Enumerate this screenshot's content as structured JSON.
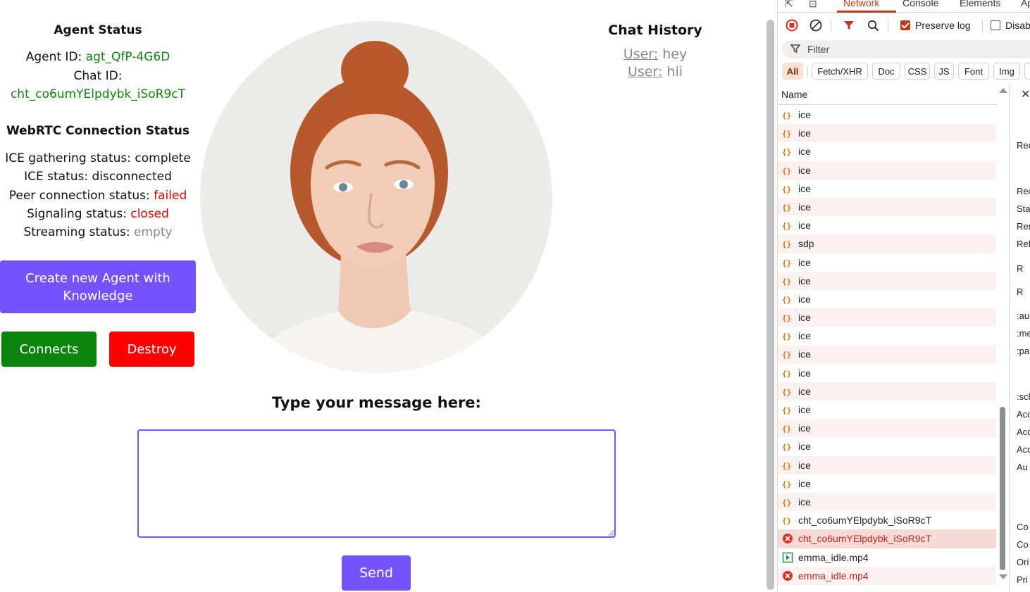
{
  "agent_status": {
    "title": "Agent Status",
    "agent_id_label": "Agent ID: ",
    "agent_id_value": "agt_QfP-4G6D",
    "chat_id_label": "Chat ID:",
    "chat_id_value": "cht_co6umYElpdybk_iSoR9cT"
  },
  "webrtc": {
    "title": "WebRTC Connection Status",
    "ice_gathering_label": "ICE gathering status: ",
    "ice_gathering_value": "complete",
    "ice_label": "ICE status: ",
    "ice_value": "disconnected",
    "peer_label": "Peer connection status: ",
    "peer_value": "failed",
    "signaling_label": "Signaling status: ",
    "signaling_value": "closed",
    "streaming_label": "Streaming status: ",
    "streaming_value": "empty"
  },
  "buttons": {
    "create": "Create new Agent with Knowledge",
    "connect": "Connects",
    "destroy": "Destroy",
    "send": "Send"
  },
  "chat_history": {
    "title": "Chat History",
    "messages": [
      {
        "user": "User:",
        "text": " hey"
      },
      {
        "user": "User:",
        "text": " hii"
      }
    ]
  },
  "message": {
    "label": "Type your message here:",
    "value": ""
  },
  "colors": {
    "accent": "#7352ff",
    "connect": "#0a840a",
    "destroy": "#ff0000",
    "status_green": "#128212",
    "status_red": "#ee0000"
  },
  "devtools": {
    "tabs": [
      "Network",
      "Console",
      "Elements",
      "Ap"
    ],
    "active_tab": "Network",
    "preserve_log": "Preserve log",
    "disable_cache": "Disab",
    "filter_placeholder": "Filter",
    "chips": [
      "All",
      "Fetch/XHR",
      "Doc",
      "CSS",
      "JS",
      "Font",
      "Img"
    ],
    "column_name": "Name",
    "rows": [
      {
        "name": "ice",
        "type": "xhr"
      },
      {
        "name": "ice",
        "type": "xhr"
      },
      {
        "name": "ice",
        "type": "xhr"
      },
      {
        "name": "ice",
        "type": "xhr"
      },
      {
        "name": "ice",
        "type": "xhr"
      },
      {
        "name": "ice",
        "type": "xhr"
      },
      {
        "name": "ice",
        "type": "xhr"
      },
      {
        "name": "sdp",
        "type": "xhr"
      },
      {
        "name": "ice",
        "type": "xhr"
      },
      {
        "name": "ice",
        "type": "xhr"
      },
      {
        "name": "ice",
        "type": "xhr"
      },
      {
        "name": "ice",
        "type": "xhr"
      },
      {
        "name": "ice",
        "type": "xhr"
      },
      {
        "name": "ice",
        "type": "xhr"
      },
      {
        "name": "ice",
        "type": "xhr"
      },
      {
        "name": "ice",
        "type": "xhr"
      },
      {
        "name": "ice",
        "type": "xhr"
      },
      {
        "name": "ice",
        "type": "xhr"
      },
      {
        "name": "ice",
        "type": "xhr"
      },
      {
        "name": "ice",
        "type": "xhr"
      },
      {
        "name": "ice",
        "type": "xhr"
      },
      {
        "name": "ice",
        "type": "xhr"
      },
      {
        "name": "cht_co6umYElpdybk_iSoR9cT",
        "type": "xhr"
      },
      {
        "name": "cht_co6umYElpdybk_iSoR9cT",
        "type": "error"
      },
      {
        "name": "emma_idle.mp4",
        "type": "media"
      },
      {
        "name": "emma_idle.mp4",
        "type": "error"
      }
    ],
    "detail_labels": [
      "Rec",
      "Rec",
      "Sta",
      "Ren",
      "Ref",
      "R",
      "R",
      ":au",
      ":me",
      ":pa",
      ":sch",
      "Acc",
      "Acc",
      "Acc",
      "Au",
      "Co",
      "Co",
      "Ori",
      "Pri"
    ]
  }
}
